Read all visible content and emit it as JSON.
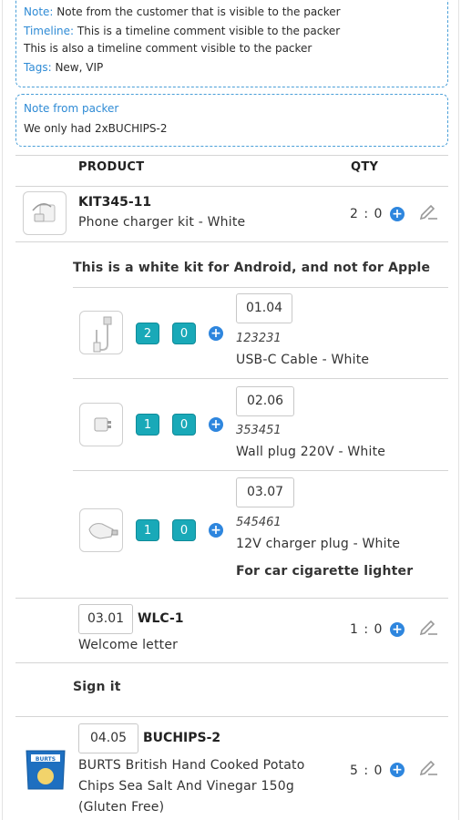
{
  "order_notes": {
    "note_label": "Note:",
    "note_text": "Note from the customer that is visible to the packer",
    "timeline_label": "Timeline:",
    "timeline_text_1": "This is a timeline comment visible to the packer",
    "timeline_text_2": "This is also a timeline comment visible to the packer",
    "tags_label": "Tags:",
    "tags_text": "New, VIP"
  },
  "packer_note": {
    "label": "Note from packer",
    "text": "We only had 2xBUCHIPS-2"
  },
  "table": {
    "col_product": "PRODUCT",
    "col_qty": "QTY"
  },
  "lines": [
    {
      "sku": "KIT345-11",
      "name": "Phone charger kit - White",
      "qty": "2 : 0",
      "note": "This is a white kit for Android, and not for Apple",
      "components": [
        {
          "location": "01.04",
          "picked": "2",
          "missing": "0",
          "barcode": "123231",
          "name": "USB-C Cable - White",
          "icon": "usb-cable-icon"
        },
        {
          "location": "02.06",
          "picked": "1",
          "missing": "0",
          "barcode": "353451",
          "name": "Wall plug 220V - White",
          "icon": "wall-plug-icon"
        },
        {
          "location": "03.07",
          "picked": "1",
          "missing": "0",
          "barcode": "545461",
          "name": "12V charger plug - White",
          "note": "For car cigarette lighter",
          "icon": "car-charger-icon"
        }
      ]
    },
    {
      "location": "03.01",
      "sku": "WLC-1",
      "name": "Welcome letter",
      "qty": "1 : 0",
      "note": "Sign it"
    },
    {
      "location": "04.05",
      "sku": "BUCHIPS-2",
      "name_line_1": "BURTS British Hand Cooked Potato",
      "name_line_2": "Chips Sea Salt And Vinegar 150g",
      "name_line_3": "(Gluten Free)",
      "qty": "5 : 0",
      "thumb_brand": "BURTS"
    }
  ],
  "colors": {
    "accent_blue": "#2e86de",
    "note_label_blue": "#2f8bd5",
    "chip_teal": "#19a9b8"
  }
}
